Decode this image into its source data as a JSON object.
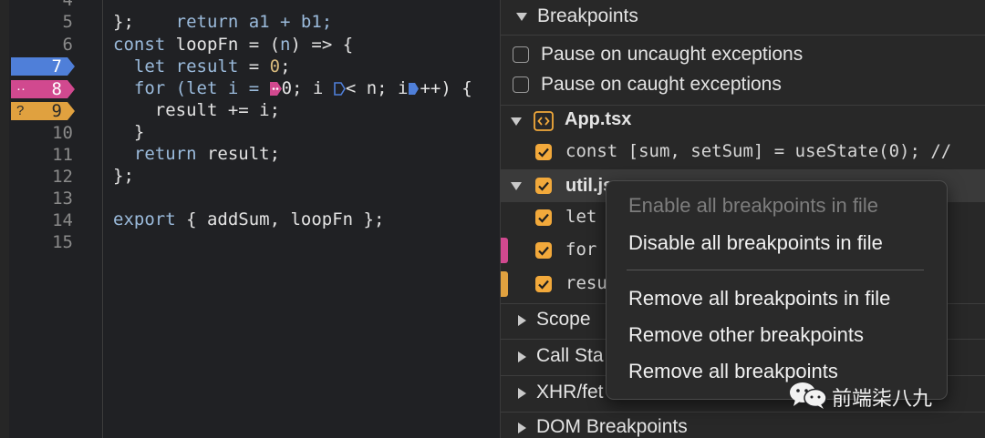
{
  "editor": {
    "line_numbers": [
      "4",
      "5",
      "6",
      "7",
      "8",
      "9",
      "10",
      "11",
      "12",
      "13",
      "14",
      "15"
    ],
    "lines": {
      "l4": "  return a1 + b1;",
      "l5": "};",
      "l6_a": "const ",
      "l6_b": "loopFn",
      "l6_c": " = (",
      "l6_d": "n",
      "l6_e": ") => {",
      "l7_a": "  let ",
      "l7_b": "result",
      "l7_c": " = ",
      "l7_d": "0",
      "l7_e": ";",
      "l8_a": "  for (",
      "l8_b": "let",
      "l8_c": " i = ",
      "l8_d": "0; i ",
      "l8_e": "< n; i",
      "l8_f": "++) {",
      "l9": "    result += i;",
      "l10": "  }",
      "l11_a": "  return ",
      "l11_b": "result;",
      "l12": "};",
      "l14_a": "export",
      "l14_b": " { addSum, loopFn };"
    },
    "breakpoints": [
      {
        "line": "7",
        "symbol": "",
        "color": "#4f7fd9"
      },
      {
        "line": "8",
        "symbol": "··",
        "color": "#d1498f"
      },
      {
        "line": "9",
        "symbol": "?",
        "color": "#e0a13f"
      }
    ]
  },
  "sidebar": {
    "breakpoints_title": "Breakpoints",
    "pause_uncaught": "Pause on uncaught exceptions",
    "pause_caught": "Pause on caught exceptions",
    "files": [
      {
        "name": "App.tsx",
        "entries": [
          "const [sum, setSum] = useState(0); //"
        ]
      },
      {
        "name": "util.js",
        "entries": [
          "let",
          "for",
          "resu"
        ]
      }
    ],
    "sections": [
      "Scope",
      "Call Sta",
      "XHR/fet",
      "DOM Breakpoints"
    ]
  },
  "context_menu": {
    "items": [
      {
        "label": "Enable all breakpoints in file",
        "enabled": false
      },
      {
        "label": "Disable all breakpoints in file",
        "enabled": true
      },
      {
        "label": "Remove all breakpoints in file",
        "enabled": true
      },
      {
        "label": "Remove other breakpoints",
        "enabled": true
      },
      {
        "label": "Remove all breakpoints",
        "enabled": true
      }
    ]
  },
  "watermark": {
    "text": "前端柒八九",
    "icon": "wechat-icon"
  },
  "colors": {
    "accent_checkbox": "#f2a93b",
    "bp_blue": "#4f7fd9",
    "bp_pink": "#d1498f",
    "bp_orange": "#e0a13f"
  }
}
